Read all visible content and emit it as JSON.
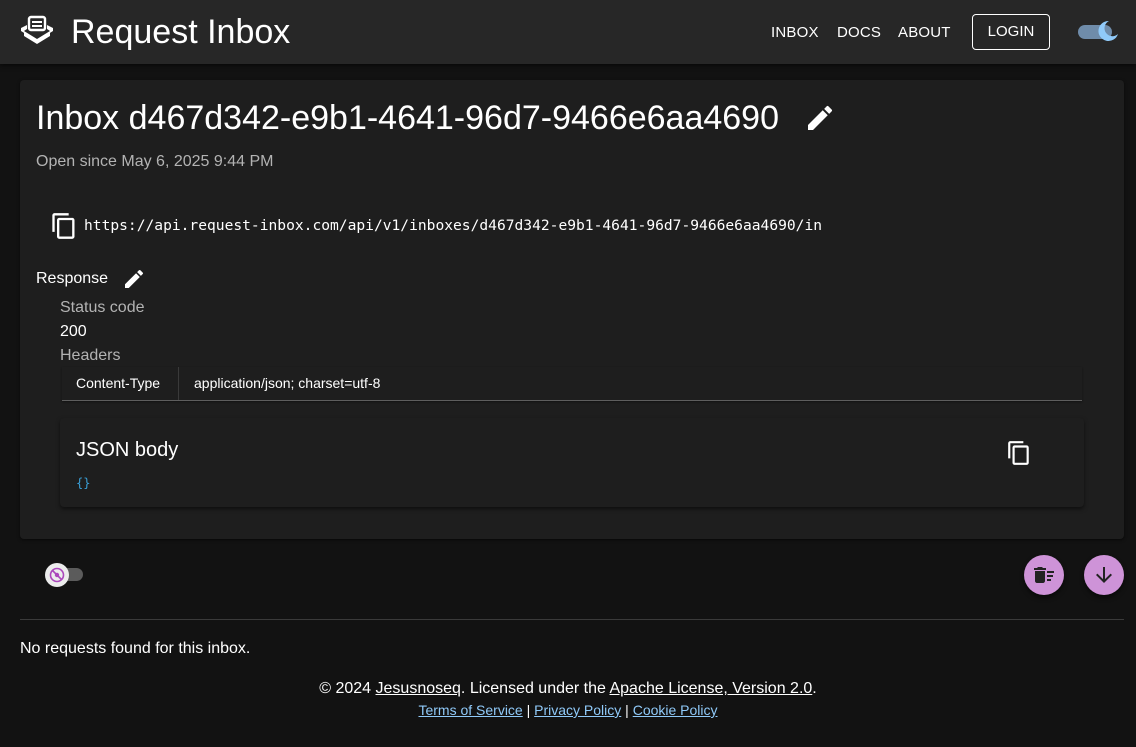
{
  "header": {
    "title": "Request Inbox",
    "nav": [
      "INBOX",
      "DOCS",
      "ABOUT"
    ],
    "login_label": "LOGIN",
    "theme_toggle": "dark-mode"
  },
  "inbox": {
    "title": "Inbox d467d342-e9b1-4641-96d7-9466e6aa4690",
    "open_since": "Open since May 6, 2025 9:44 PM",
    "url": "https://api.request-inbox.com/api/v1/inboxes/d467d342-e9b1-4641-96d7-9466e6aa4690/in"
  },
  "response": {
    "label": "Response",
    "status_label": "Status code",
    "status_value": "200",
    "headers_label": "Headers",
    "headers": [
      {
        "key": "Content-Type",
        "value": "application/json; charset=utf-8"
      }
    ],
    "json_title": "JSON body",
    "json_body": "{}"
  },
  "requests": {
    "empty_message": "No requests found for this inbox."
  },
  "footer": {
    "copyright_prefix": "© 2024 ",
    "author": "Jesusnoseq",
    "licensed_text": ". Licensed under the ",
    "license": "Apache License, Version 2.0",
    "period": ".",
    "terms": "Terms of Service",
    "sep": " | ",
    "privacy": "Privacy Policy",
    "cookie": "Cookie Policy"
  },
  "colors": {
    "appbar": "#272727",
    "background": "#121212",
    "card": "#1e1e1e",
    "fab": "#ce93d8",
    "link": "#90caf9",
    "json": "#3aa0d8"
  }
}
